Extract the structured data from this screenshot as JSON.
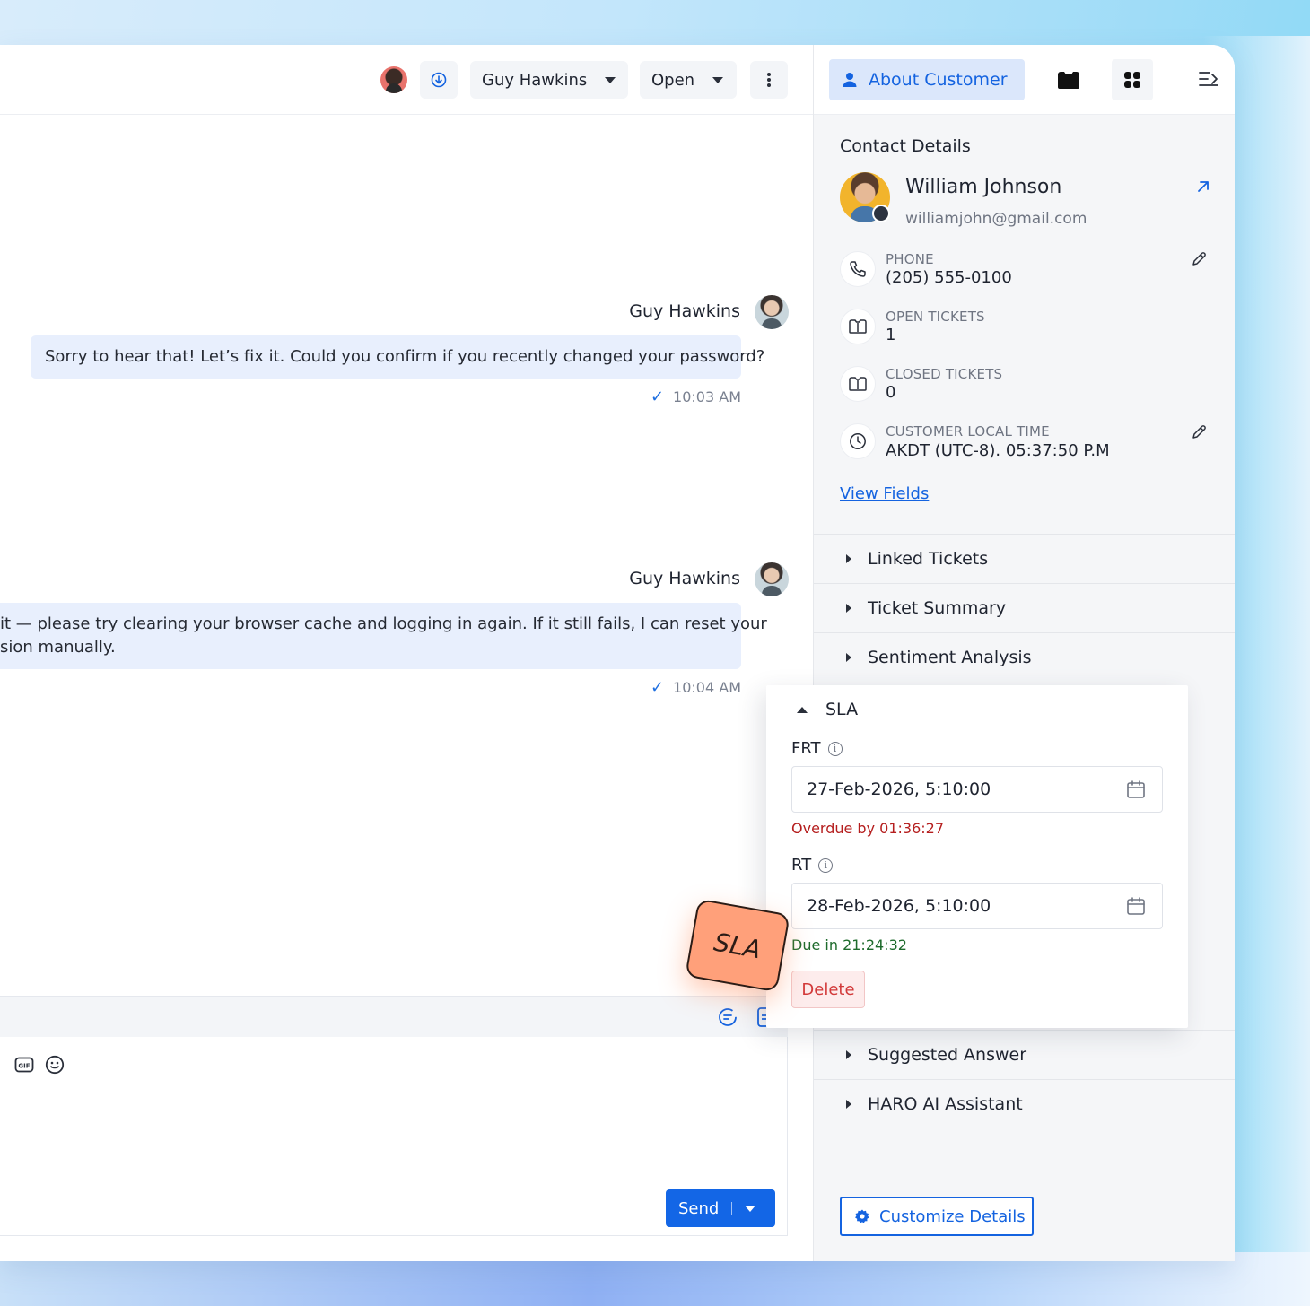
{
  "header": {
    "assignee": "Guy Hawkins",
    "status": "Open"
  },
  "messages": [
    {
      "sender": "Guy Hawkins",
      "text": "Sorry to hear that! Let’s fix it. Could you confirm if you recently changed your password?",
      "time": "10:03 AM"
    },
    {
      "sender": "Guy Hawkins",
      "text_line1": "it — please try clearing your browser cache and logging in again. If it still fails, I can reset your",
      "text_line2": "sion manually.",
      "time": "10:04 AM"
    }
  ],
  "composer": {
    "send_label": "Send"
  },
  "panel": {
    "tab_about": "About Customer",
    "contact_title": "Contact Details",
    "customer": {
      "name": "William Johnson",
      "email": "williamjohn@gmail.com"
    },
    "fields": [
      {
        "label": "PHONE",
        "value": "(205) 555-0100"
      },
      {
        "label": "OPEN TICKETS",
        "value": "1"
      },
      {
        "label": "CLOSED TICKETS",
        "value": "0"
      },
      {
        "label": "CUSTOMER LOCAL TIME",
        "value": "AKDT (UTC-8). 05:37:50 P.M"
      }
    ],
    "view_fields": "View Fields",
    "accordion_top": [
      "Linked Tickets",
      "Ticket Summary",
      "Sentiment Analysis"
    ],
    "accordion_bottom": [
      "Suggested Answer",
      "HARO AI Assistant"
    ],
    "customize": "Customize Details"
  },
  "sla": {
    "title": "SLA",
    "frt_label": "FRT",
    "frt_value": "27-Feb-2026, 5:10:00",
    "frt_status": "Overdue by 01:36:27",
    "rt_label": "RT",
    "rt_value": "28-Feb-2026, 5:10:00",
    "rt_status": "Due in 21:24:32",
    "delete_label": "Delete",
    "sticker": "SLA"
  },
  "colors": {
    "accent": "#1463e0",
    "send": "#1366e6",
    "overdue": "#b51e1e",
    "due": "#1e6b2c",
    "sticker": "#ffa07a"
  }
}
